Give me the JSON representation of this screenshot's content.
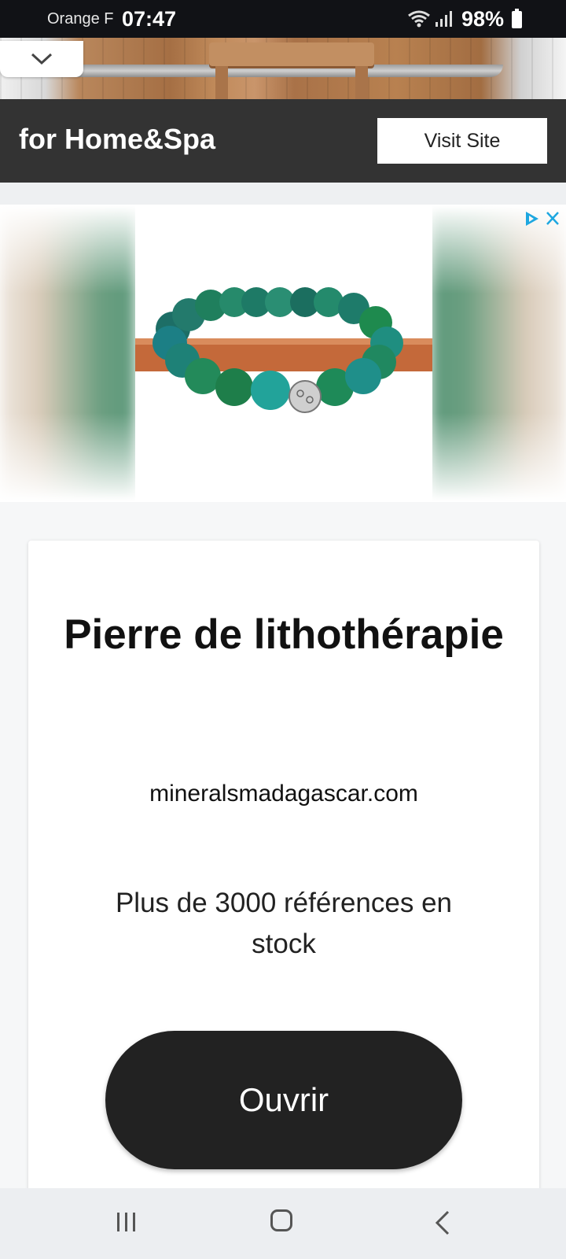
{
  "status_bar": {
    "carrier": "Orange F",
    "time": "07:47",
    "battery": "98%",
    "icons": [
      "wifi-icon",
      "signal-icon",
      "battery-icon"
    ]
  },
  "top_ad": {
    "headline": "for Home&Spa",
    "cta_label": "Visit Site",
    "collapse_icon": "chevron-down-icon"
  },
  "main_ad": {
    "adchoices_icons": [
      "adchoices-icon",
      "close-icon"
    ],
    "title": "Pierre de lithothérapie",
    "domain": "mineralsmadagascar.com",
    "description": "Plus de 3000 références en stock",
    "cta_label": "Ouvrir"
  },
  "nav_bar": {
    "items": [
      "recents-icon",
      "home-icon",
      "back-icon"
    ]
  },
  "colors": {
    "status_bar_bg": "#111216",
    "ad_bar_bg": "#333333",
    "button_dark": "#222222",
    "adchoices_blue": "#1ea7e0"
  }
}
